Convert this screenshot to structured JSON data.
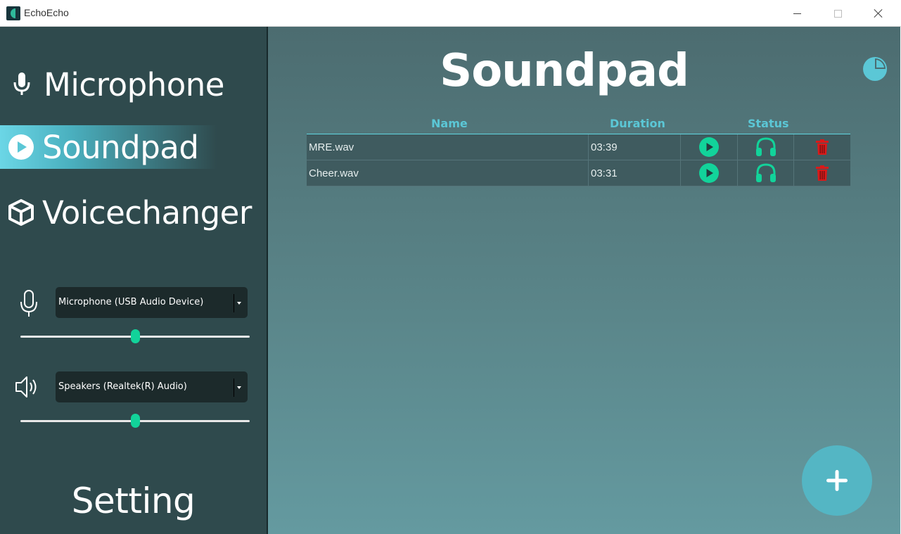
{
  "window": {
    "title": "EchoEcho"
  },
  "sidebar": {
    "items": [
      {
        "label": "Microphone",
        "icon": "microphone-icon",
        "active": false
      },
      {
        "label": "Soundpad",
        "icon": "play-circle-icon",
        "active": true
      },
      {
        "label": "Voicechanger",
        "icon": "cube-icon",
        "active": false
      }
    ],
    "input_device": {
      "selected": "Microphone (USB Audio Device)",
      "icon": "microphone-outline-icon",
      "volume": 0.5
    },
    "output_device": {
      "selected": "Speakers (Realtek(R) Audio)",
      "icon": "speaker-icon",
      "volume": 0.5
    },
    "setting_label": "Setting"
  },
  "main": {
    "title": "Soundpad",
    "columns": {
      "name": "Name",
      "duration": "Duration",
      "status": "Status"
    },
    "rows": [
      {
        "name": "MRE.wav",
        "duration": "03:39"
      },
      {
        "name": "Cheer.wav",
        "duration": "03:31"
      }
    ],
    "add_button_icon": "plus-icon"
  },
  "colors": {
    "sidebar_bg": "#2f4a4d",
    "accent_teal": "#5bc7d6",
    "play_green": "#12d39a",
    "delete_red": "#d91a1a",
    "fab_bg": "#54b6c4"
  }
}
